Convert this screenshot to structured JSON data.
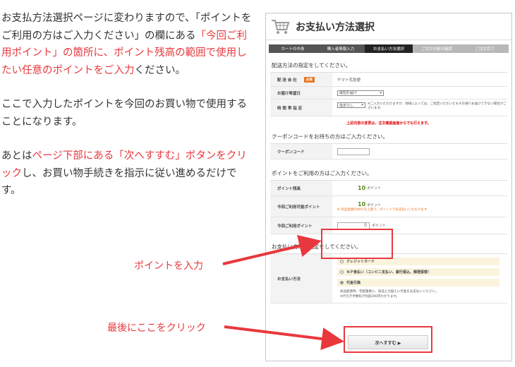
{
  "explanation": {
    "p1_a": "お支払方法選択ページに変わりますので、「ポイントをご利用の方はご入力ください」の欄にある",
    "p1_red": "「今回ご利用ポイント」の箇所に、ポイント残高の範囲で使用したい任意のポイントをご入力",
    "p1_b": "ください。",
    "p2": "ここで入力したポイントを今回のお買い物で使用することになります。",
    "p3_a": "あとは",
    "p3_red": "ページ下部にある「次へすすむ」ボタンをクリック",
    "p3_b": "し、お買い物手続きを指示に従い進めるだけです。"
  },
  "callouts": {
    "points": "ポイントを入力",
    "click": "最後にここをクリック"
  },
  "panel": {
    "title": "お支払い方法選択",
    "steps": [
      "カートの中身",
      "購入者情報入力",
      "お支払い方法選択",
      "ご注文内容の確認",
      "ご注文完了"
    ],
    "delivery": {
      "heading": "配送方法の指定をしてください。",
      "company_label": "配 送 会 社",
      "required_badge": "必須",
      "company_value": "ヤマト宅急便",
      "date_label": "お届け希望日",
      "date_value": "最短お届け",
      "time_label": "時 間 帯 指 定",
      "time_value": "指定なし",
      "time_note": "※ご入力いただけますが、地域によっては、ご指定いただいたもその通りお届けできない場合がございます。",
      "notice": "上記内容の変更は、注文確認画面からでも行えます。"
    },
    "coupon": {
      "heading": "クーポンコードをお持ちの方はご入力ください。",
      "label": "クーポンコード"
    },
    "points": {
      "heading": "ポイントをご利用の方はご入力ください。",
      "balance_label": "ポイント残高",
      "balance_value": "10",
      "unit": "ポイント",
      "usable_label": "今回ご利用可能ポイント",
      "usable_value": "10",
      "usable_note": "※ 商品金額の90%を上限で、ポイントでお支払いいただけます",
      "use_label": "今回ご利用ポイント",
      "use_value": "0"
    },
    "payment": {
      "heading": "お支払い方法の指定をしてください。",
      "label": "お支払い方法",
      "options": [
        "クレジットカード",
        "ＮＰ後払い（コンビニ支払い、銀行振込、郵便振替）",
        "代金引換"
      ],
      "cod_note1": "商品配達時、宅配業者に、商品と引換えに代金をお支払いください。",
      "cod_note2": "※代引き手数料が別途300円かかります。"
    },
    "next_button": "次へすすむ ▶"
  },
  "colors": {
    "accent_red": "#e8383d",
    "badge_orange": "#e8741e"
  }
}
